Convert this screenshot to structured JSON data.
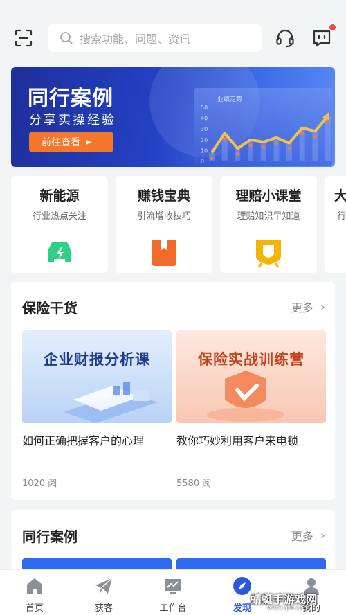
{
  "header": {
    "search_placeholder": "搜索功能、问题、资讯",
    "has_unread_message": true
  },
  "banner": {
    "title": "同行案例",
    "subtitle": "分享实操经验",
    "cta_label": "前往查看",
    "chart_title": "业绩走势",
    "chart_ticks": [
      "50",
      "40",
      "30",
      "20",
      "10",
      "0"
    ],
    "chart_points": [
      8,
      26,
      12,
      20,
      18,
      22,
      17,
      31,
      28,
      42
    ]
  },
  "categories": [
    {
      "title": "新能源",
      "subtitle": "行业热点关注",
      "icon": "electric-car-icon",
      "color": "#2fcf87"
    },
    {
      "title": "赚钱宝典",
      "subtitle": "引流增收技巧",
      "icon": "book-bookmark-icon",
      "color": "#f36b2b"
    },
    {
      "title": "理赔小课堂",
      "subtitle": "理赔知识早知道",
      "icon": "shield-badge-icon",
      "color": "#f5b400"
    },
    {
      "title": "大",
      "subtitle": "行",
      "icon": "unknown-icon",
      "color": "#cccccc"
    }
  ],
  "insurance_tips": {
    "heading": "保险干货",
    "more_label": "更多",
    "articles": [
      {
        "thumb_text": "企业财报分析课",
        "title": "如何正确把握客户的心理",
        "reads": "1020 阅"
      },
      {
        "thumb_text": "保险实战训练营",
        "title": "教你巧妙利用客户来电锁",
        "reads": "5580 阅"
      }
    ]
  },
  "peer_cases": {
    "heading": "同行案例",
    "more_label": "更多"
  },
  "tabbar": {
    "tabs": [
      {
        "label": "首页",
        "icon": "home-icon",
        "active": false
      },
      {
        "label": "获客",
        "icon": "paper-plane-icon",
        "active": false
      },
      {
        "label": "工作台",
        "icon": "dashboard-icon",
        "active": false
      },
      {
        "label": "发现",
        "icon": "compass-icon",
        "active": true
      },
      {
        "label": "我的",
        "icon": "user-icon",
        "active": false
      }
    ]
  },
  "watermark": {
    "text": "蜻蜓手游戏网",
    "url": "www.qt6.com"
  },
  "colors": {
    "accent": "#2a59e0",
    "cta": "#f5772c",
    "badge": "#f04a3a"
  }
}
